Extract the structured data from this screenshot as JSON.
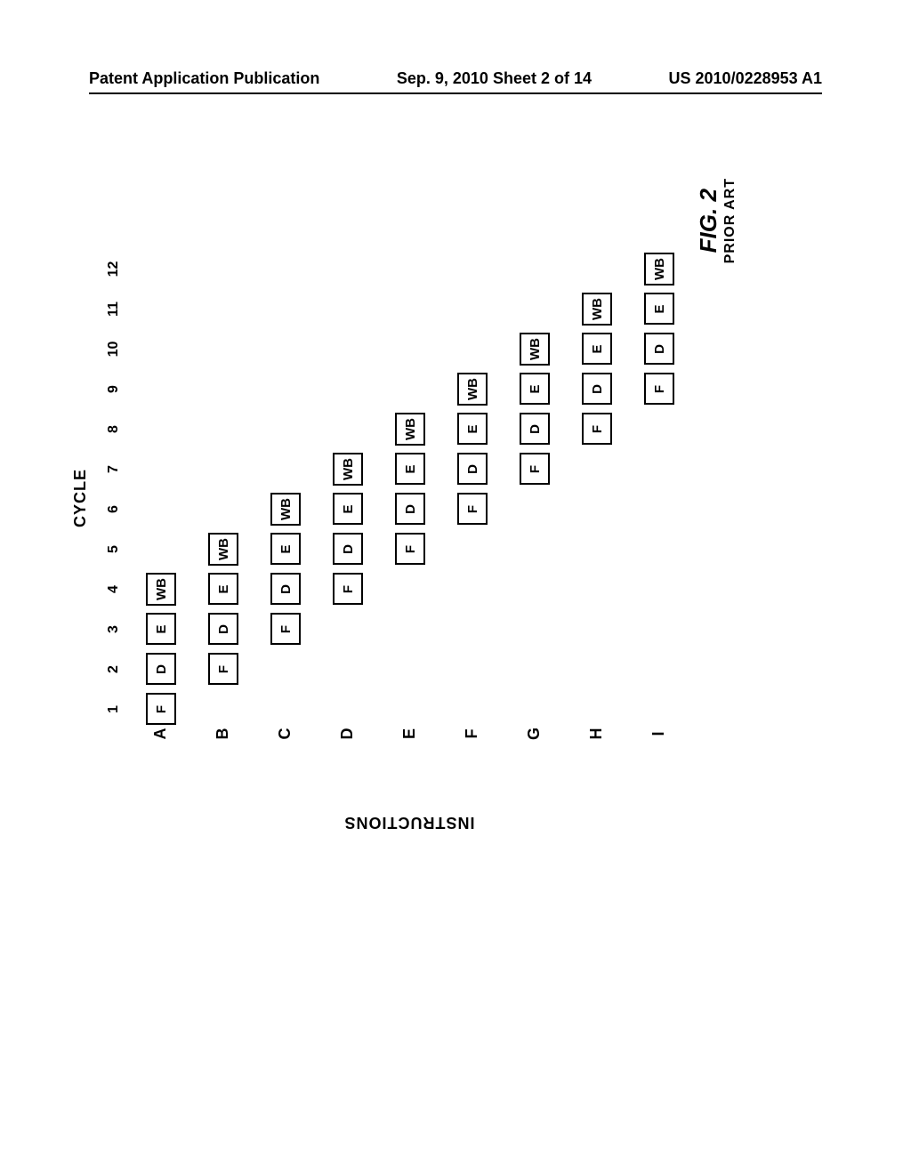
{
  "header": {
    "left": "Patent Application Publication",
    "center": "Sep. 9, 2010  Sheet 2 of 14",
    "right": "US 2010/0228953 A1"
  },
  "chart_data": {
    "type": "table",
    "title": "",
    "x_axis_label": "CYCLE",
    "y_axis_label": "INSTRUCTIONS",
    "cycles": [
      "1",
      "2",
      "3",
      "4",
      "5",
      "6",
      "7",
      "8",
      "9",
      "10",
      "11",
      "12"
    ],
    "instructions": [
      "A",
      "B",
      "C",
      "D",
      "E",
      "F",
      "G",
      "H",
      "I"
    ],
    "stages": {
      "F": "F",
      "D": "D",
      "E": "E",
      "WB": "WB"
    },
    "pipeline": {
      "A": {
        "1": "F",
        "2": "D",
        "3": "E",
        "4": "WB"
      },
      "B": {
        "2": "F",
        "3": "D",
        "4": "E",
        "5": "WB"
      },
      "C": {
        "3": "F",
        "4": "D",
        "5": "E",
        "6": "WB"
      },
      "D": {
        "4": "F",
        "5": "D",
        "6": "E",
        "7": "WB"
      },
      "E": {
        "5": "F",
        "6": "D",
        "7": "E",
        "8": "WB"
      },
      "F": {
        "6": "F",
        "7": "D",
        "8": "E",
        "9": "WB"
      },
      "G": {
        "7": "F",
        "8": "D",
        "9": "E",
        "10": "WB"
      },
      "H": {
        "8": "F",
        "9": "D",
        "10": "E",
        "11": "WB"
      },
      "I": {
        "9": "F",
        "10": "D",
        "11": "E",
        "12": "WB"
      }
    }
  },
  "caption": {
    "fig": "FIG. 2",
    "sub": "PRIOR ART"
  }
}
